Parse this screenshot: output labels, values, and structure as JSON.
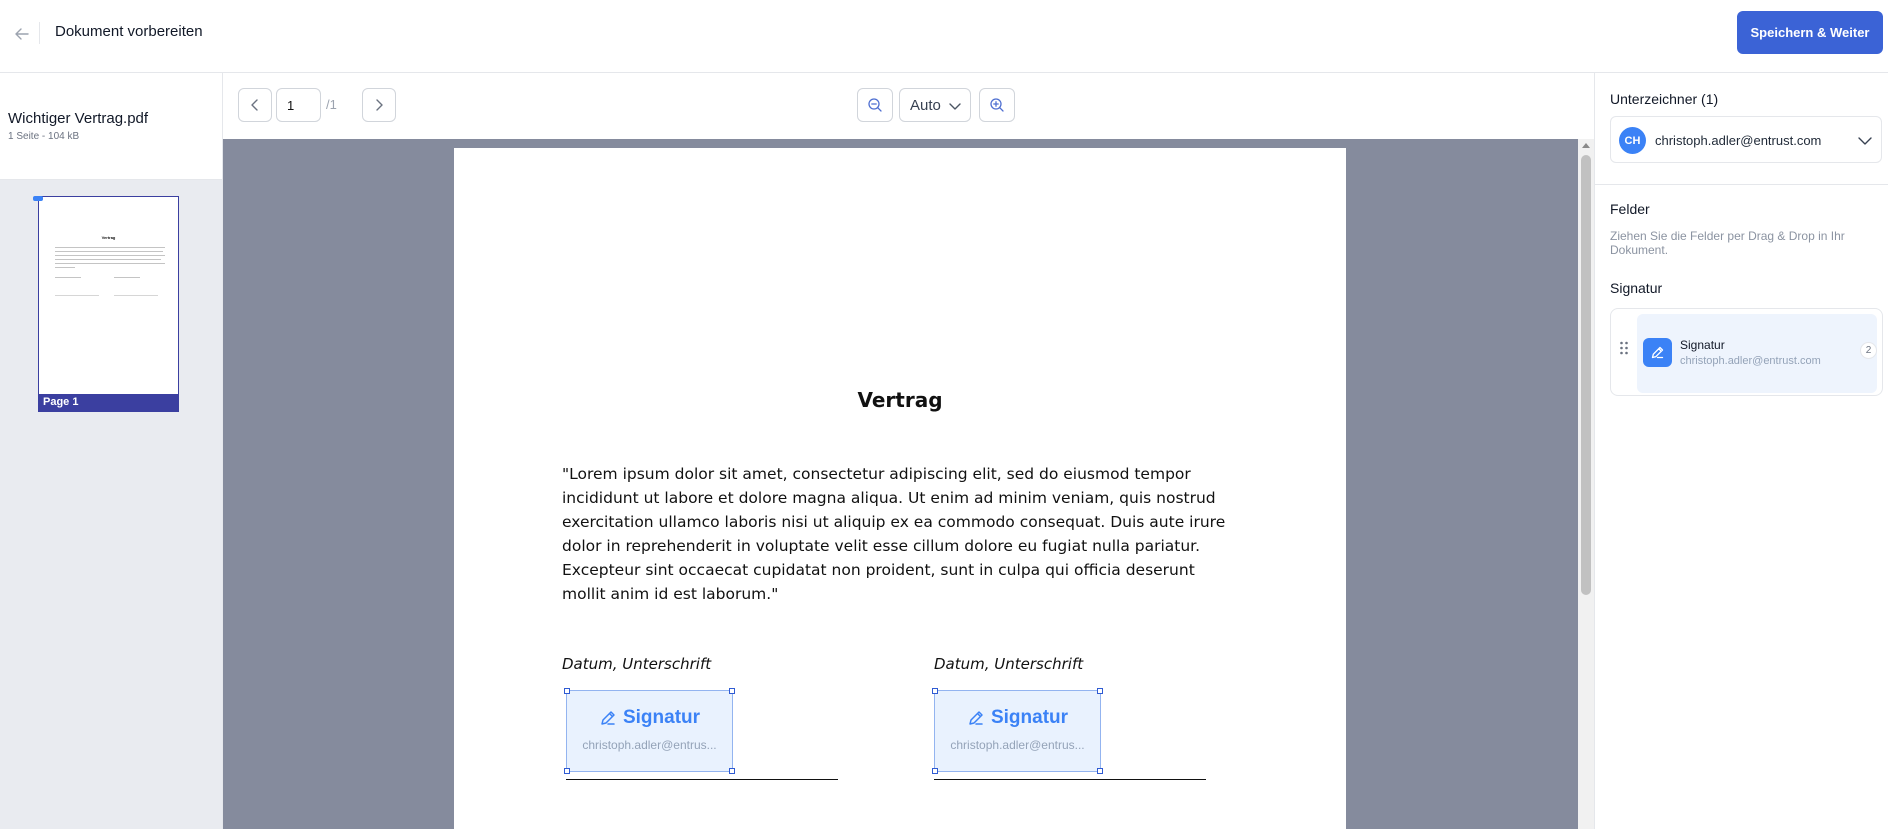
{
  "header": {
    "title": "Dokument vorbereiten",
    "primary_action": "Speichern & Weiter"
  },
  "file": {
    "name": "Wichtiger Vertrag.pdf",
    "meta": "1 Seite - 104 kB",
    "thumbnail_label": "Page 1",
    "thumbnail_title": "Vertrag"
  },
  "toolbar": {
    "page_value": "1",
    "page_total": "/1",
    "zoom": "Auto"
  },
  "document": {
    "title": "Vertrag",
    "body": "\"Lorem ipsum dolor sit amet, consectetur adipiscing elit, sed do eiusmod tempor incididunt ut labore et dolore magna aliqua. Ut enim ad minim veniam, quis nostrud exercitation ullamco laboris nisi ut aliquip ex ea commodo consequat. Duis aute irure dolor in reprehenderit in voluptate velit esse cillum dolore eu fugiat nulla pariatur. Excepteur sint occaecat cupidatat non proident, sunt in culpa qui officia deserunt mollit anim id est laborum.\"",
    "signature_blocks": [
      {
        "caption": "Datum, Unterschrift",
        "field_label": "Signatur",
        "field_email": "christoph.adler@entrus..."
      },
      {
        "caption": "Datum, Unterschrift",
        "field_label": "Signatur",
        "field_email": "christoph.adler@entrus..."
      }
    ]
  },
  "sidebar_right": {
    "signers_heading": "Unterzeichner (1)",
    "signer": {
      "initials": "CH",
      "email": "christoph.adler@entrust.com"
    },
    "fields_heading": "Felder",
    "fields_hint": "Ziehen Sie die Felder per Drag & Drop in Ihr Dokument.",
    "signature_heading": "Signatur",
    "field_item": {
      "label": "Signatur",
      "email": "christoph.adler@entrust.com",
      "count": "2"
    }
  },
  "colors": {
    "primary": "#3b63d6",
    "accent": "#3b82f6",
    "viewer_bg": "#858b9d",
    "thumbnail_border": "#3b3fa0"
  },
  "icons": {
    "back": "arrow-left-icon",
    "prev": "chevron-left-icon",
    "next": "chevron-right-icon",
    "zoom_out": "zoom-out-icon",
    "zoom_in": "zoom-in-icon",
    "dropdown": "chevron-down-icon",
    "signature": "pen-edit-icon",
    "drag": "drag-dots-icon"
  }
}
